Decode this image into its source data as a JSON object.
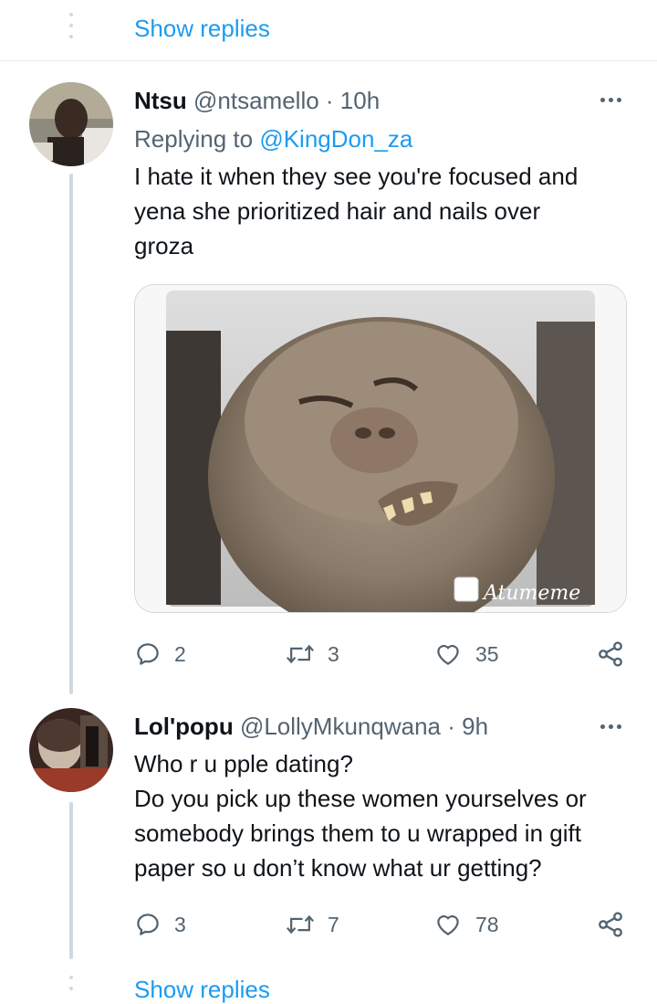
{
  "thread": {
    "show_replies_top": "Show replies",
    "show_replies_bottom": "Show replies"
  },
  "tweets": [
    {
      "name": "Ntsu",
      "handle": "@ntsamello",
      "time": "· 10h",
      "replying_label": "Replying to",
      "replying_handle": "@KingDon_za",
      "text_lines": [
        "I hate it when they see you're focused and",
        "yena she prioritized hair and nails over",
        "groza"
      ],
      "media_watermark": "Atumeme",
      "replies": "2",
      "retweets": "3",
      "likes": "35"
    },
    {
      "name": "Lol'popu",
      "handle": "@LollyMkunqwana",
      "time": "· 9h",
      "text_lines": [
        "Who r u pple dating?",
        "Do you pick up these women yourselves or",
        "somebody brings them to u wrapped in gift",
        "paper so u don’t know what ur getting?"
      ],
      "replies": "3",
      "retweets": "7",
      "likes": "78"
    }
  ],
  "colors": {
    "accent": "#1d9bf0",
    "text": "#0f1419",
    "secondary": "#536471",
    "line": "#cfd9de"
  },
  "icons": {
    "reply": "reply-icon",
    "retweet": "retweet-icon",
    "like": "heart-icon",
    "share": "share-icon",
    "more": "more-icon"
  }
}
